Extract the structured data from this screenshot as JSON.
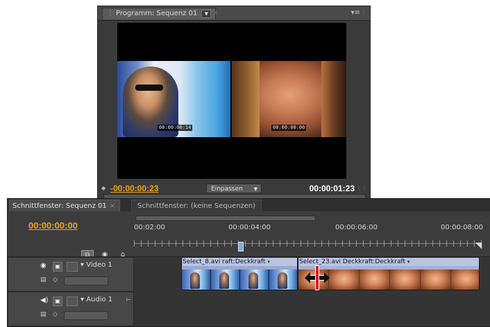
{
  "program_monitor": {
    "tab_label": "Programm: Sequenz 01",
    "current_time": "-00:00:00:23",
    "fit_option": "Einpassen",
    "duration": "00:00:01:23",
    "overlay_timecode_left": "00:00:00:14",
    "overlay_timecode_right": "00:00:00:00"
  },
  "timeline": {
    "tab_active": "Schnittfenster: Sequenz 01",
    "tab_inactive": "Schnittfenster: (keine Sequenzen)",
    "current_time": "00:00:00:00",
    "ruler_labels": [
      "00:02:00",
      "00:00:04:00",
      "00:00:06:00",
      "00:00:08:00"
    ],
    "video_track": {
      "name": "Video 1",
      "clips": [
        {
          "label": "Select_8.avi  raft:Deckkraft"
        },
        {
          "label": "Select_23.avi  Deckkraft:Deckkraft"
        }
      ]
    },
    "audio_track": {
      "name": "Audio 1"
    }
  },
  "colors": {
    "timecode_accent": "#f0a51a",
    "clip_blue": "#a3b2d7",
    "trim_red": "#d42020"
  },
  "icons": [
    "panel-menu-icon",
    "snap-icon",
    "marker-icon",
    "add-marker-icon",
    "eye-icon",
    "speaker-icon",
    "trim-cursor-icon"
  ]
}
